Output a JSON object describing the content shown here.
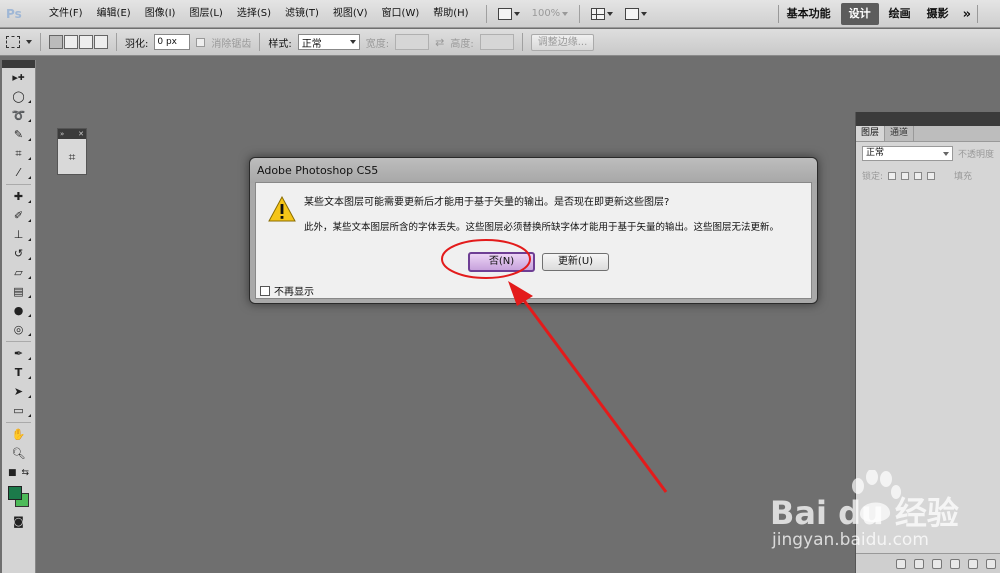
{
  "app": {
    "logo": "Ps"
  },
  "menu": [
    "文件(F)",
    "编辑(E)",
    "图像(I)",
    "图层(L)",
    "选择(S)",
    "滤镜(T)",
    "视图(V)",
    "窗口(W)",
    "帮助(H)"
  ],
  "menubar_tools": {
    "zoom": "100%"
  },
  "workspace": {
    "items": [
      "基本功能",
      "设计",
      "绘画",
      "摄影"
    ],
    "active": "设计",
    "more": "»"
  },
  "options_bar": {
    "feather_label": "羽化:",
    "feather_value": "0 px",
    "antialias_label": "消除锯齿",
    "style_label": "样式:",
    "style_value": "正常",
    "width_label": "宽度:",
    "height_label": "高度:",
    "refine_edge_label": "调整边缘..."
  },
  "layers_panel": {
    "tabs": [
      "图层",
      "通道"
    ],
    "blend_mode": "正常",
    "opacity_label": "不透明度",
    "lock_label": "锁定:",
    "fill_label": "填充"
  },
  "dialog": {
    "title": "Adobe Photoshop CS5",
    "message1": "某些文本图层可能需要更新后才能用于基于矢量的输出。是否现在即更新这些图层?",
    "message2": "此外，某些文本图层所含的字体丢失。这些图层必须替换所缺字体才能用于基于矢量的输出。这些图层无法更新。",
    "no_button": "否(N)",
    "update_button": "更新(U)",
    "dont_show_label": "不再显示"
  },
  "colors": {
    "foreground": "#1b7a4a",
    "background": "#4dbb59",
    "annotation": "#e31b1b"
  },
  "watermark": {
    "brand": "Bai du 经验",
    "url": "jingyan.baidu.com"
  }
}
